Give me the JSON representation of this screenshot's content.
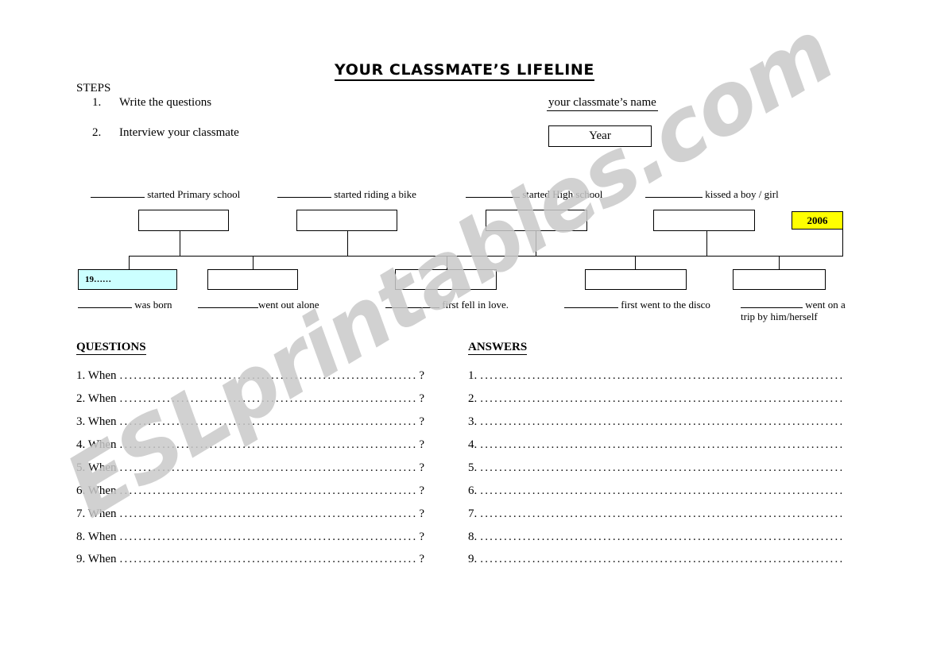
{
  "document": {
    "title": "YOUR CLASSMATE’S LIFELINE",
    "watermark": "ESLprintables.com"
  },
  "steps": {
    "heading": "STEPS",
    "items": [
      {
        "number": "1.",
        "text": "Write the questions"
      },
      {
        "number": "2.",
        "text": "Interview your classmate"
      }
    ]
  },
  "header_fields": {
    "classmate_name_label": "your classmate’s name",
    "year_box_label": "Year"
  },
  "timeline": {
    "blank_placeholder": "__________",
    "top_events": [
      {
        "label": "started Primary school",
        "box_value": ""
      },
      {
        "label": "started riding a bike",
        "box_value": ""
      },
      {
        "label": "started High school",
        "box_value": ""
      },
      {
        "label": "kissed a boy / girl",
        "box_value": ""
      }
    ],
    "top_extra_box": {
      "value": "2006",
      "fill_color": "#ffff00"
    },
    "bottom_events": [
      {
        "label": "was born",
        "box_value": "19……",
        "fill_color": "#ccffff"
      },
      {
        "label": "went out alone",
        "box_value": ""
      },
      {
        "label": "first fell in love.",
        "box_value": ""
      },
      {
        "label": "first went to the disco",
        "box_value": ""
      },
      {
        "label": "went on a",
        "label_line2": "trip by him/herself",
        "box_value": ""
      }
    ]
  },
  "questions_section": {
    "heading": "QUESTIONS",
    "rows": [
      {
        "lead": "1. When",
        "tail": "?"
      },
      {
        "lead": "2. When",
        "tail": "?"
      },
      {
        "lead": "3. When",
        "tail": "?"
      },
      {
        "lead": "4. When",
        "tail": "?"
      },
      {
        "lead": "5. When",
        "tail": "?"
      },
      {
        "lead": "6. When",
        "tail": "?"
      },
      {
        "lead": "7. When",
        "tail": "?"
      },
      {
        "lead": "8. When",
        "tail": "?"
      },
      {
        "lead": "9. When",
        "tail": "?"
      }
    ],
    "dot_leader": "......................................................................................................"
  },
  "answers_section": {
    "heading": "ANSWERS",
    "rows": [
      {
        "lead": "1.",
        "tail": ""
      },
      {
        "lead": "2.",
        "tail": ""
      },
      {
        "lead": "3.",
        "tail": ""
      },
      {
        "lead": "4.",
        "tail": ""
      },
      {
        "lead": "5.",
        "tail": ""
      },
      {
        "lead": "6.",
        "tail": ""
      },
      {
        "lead": "7.",
        "tail": ""
      },
      {
        "lead": "8.",
        "tail": ""
      },
      {
        "lead": "9.",
        "tail": ""
      }
    ],
    "dot_leader": "......................................................................................................"
  }
}
